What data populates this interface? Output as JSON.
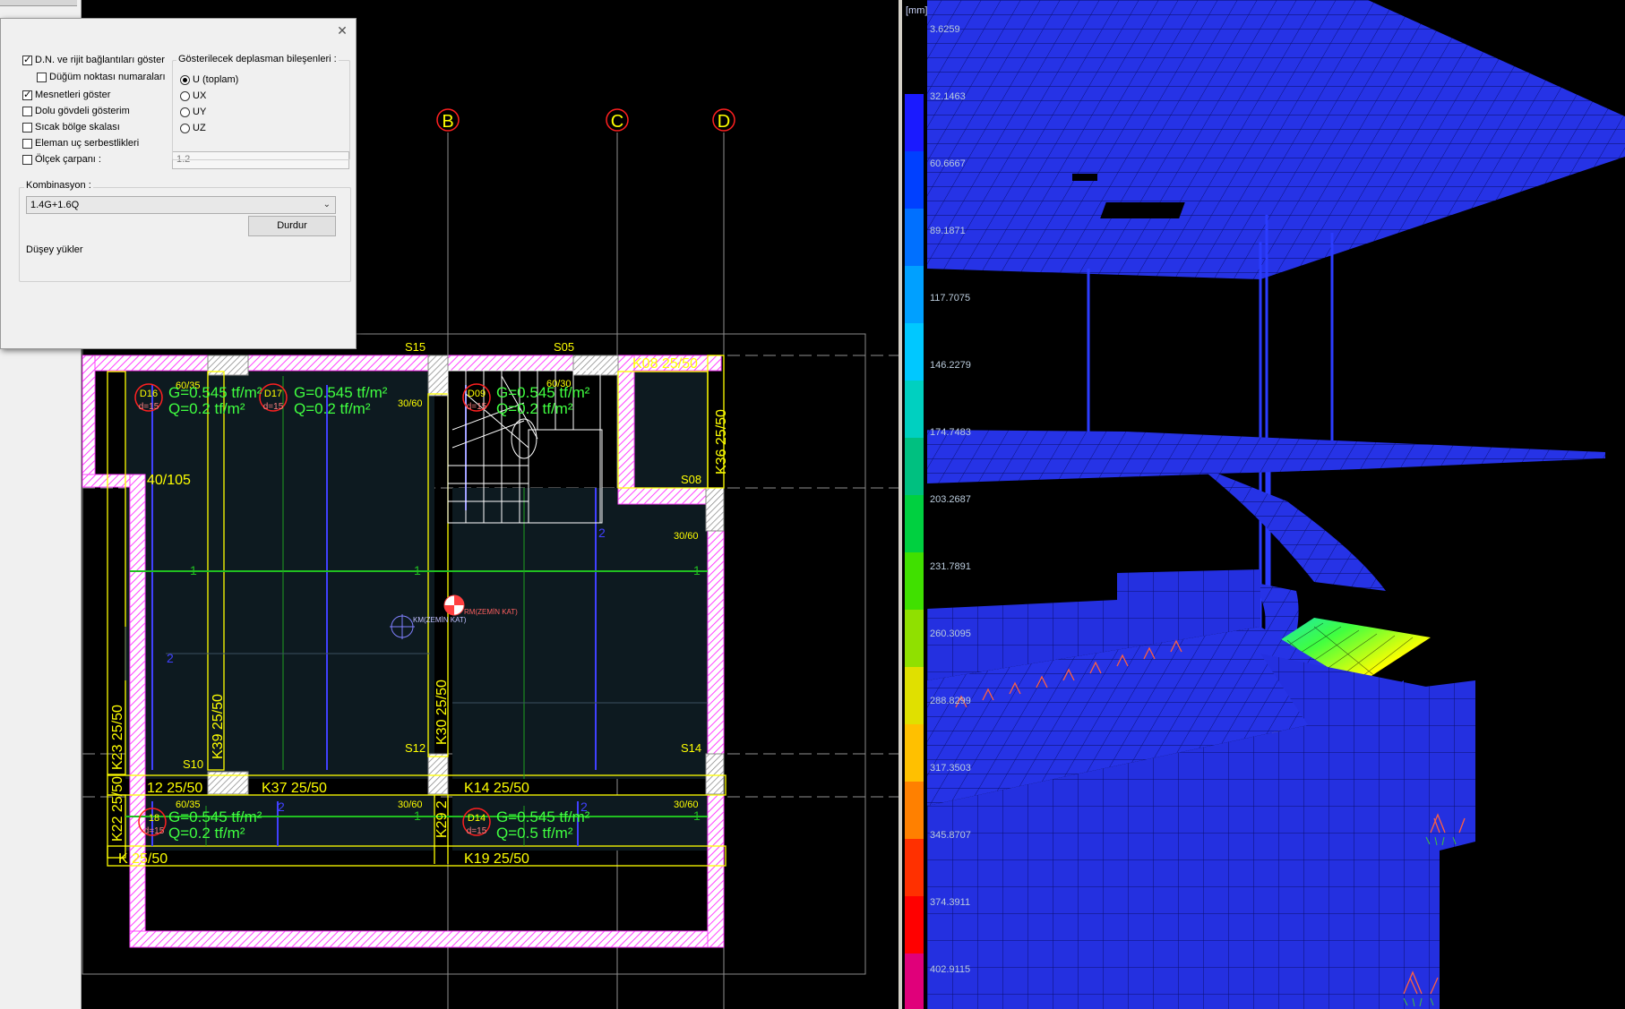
{
  "dialog": {
    "close_glyph": "✕",
    "checkboxes": [
      {
        "label": "D.N. ve rijit bağlantıları göster",
        "checked": true
      },
      {
        "label": "Düğüm noktası numaraları",
        "checked": false
      },
      {
        "label": "Mesnetleri göster",
        "checked": true
      },
      {
        "label": "Dolu gövdeli gösterim",
        "checked": false
      },
      {
        "label": "Sıcak bölge skalası",
        "checked": false
      },
      {
        "label": "Eleman uç serbestlikleri",
        "checked": false
      },
      {
        "label": "Ölçek çarpanı :",
        "checked": false
      }
    ],
    "scale_value": "1.2",
    "displacement_group_title": "Gösterilecek deplasman bileşenleri :",
    "radios": [
      {
        "label": "U (toplam)",
        "selected": true
      },
      {
        "label": "UX",
        "selected": false
      },
      {
        "label": "UY",
        "selected": false
      },
      {
        "label": "UZ",
        "selected": false
      }
    ],
    "combination_title": "Kombinasyon :",
    "combination_value": "1.4G+1.6Q",
    "stop_button": "Durdur",
    "load_label": "Düşey yükler"
  },
  "plan": {
    "axes": [
      {
        "label": "B"
      },
      {
        "label": "C"
      },
      {
        "label": "D"
      }
    ],
    "labels": {
      "s15": "S15",
      "s05": "S05",
      "s08": "S08",
      "s10": "S10",
      "s12": "S12",
      "s14": "S14",
      "k08": "K08 25/50",
      "k36": "K36 25/50",
      "k39": "K39 25/50",
      "k30": "K30 25/50",
      "k23": "K23 25/50",
      "k22": "K22 25/50",
      "k12": "12 25/50",
      "k37": "K37 25/50",
      "k14": "K14 25/50",
      "k29": "K29 2",
      "kbottom": "K   25/50",
      "k19": "K19 25/50",
      "k40": "40/105",
      "d16": "D16",
      "d17": "D17",
      "d09": "D09",
      "d18": "18",
      "d14": "D14",
      "d15": "d=15",
      "g1": "G=0.545 tf/m²",
      "q1": "Q=0.2 tf/m²",
      "g2": "G=0.545 tf/m²",
      "q2": "Q=0.2 tf/m²",
      "g3": "G=0.545 tf/m²",
      "q3": "Q=0.2 tf/m²",
      "g4": "G=0.545 tf/m²",
      "q4": "Q=0.2 tf/m²",
      "g5": "G=0.545 tf/m²",
      "q5": "Q=0.5 tf/m²",
      "c6035a": "60/35",
      "c3060a": "30/60",
      "c6030": "60/30",
      "c3060b": "30/60",
      "c6035b": "60/35",
      "c3060c": "30/60",
      "c3060d": "30/60",
      "km": "KM(ZEMİN KAT)",
      "rm": "RM(ZEMİN KAT)",
      "one": "1",
      "two": "2"
    }
  },
  "view3d": {
    "unit": "[mm]",
    "legend": [
      "3.6259",
      "32.1463",
      "60.6667",
      "89.1871",
      "117.7075",
      "146.2279",
      "174.7483",
      "203.2687",
      "231.7891",
      "260.3095",
      "288.8299",
      "317.3503",
      "345.8707",
      "374.3911",
      "402.9115"
    ],
    "legend_colors": [
      "#1a1aff",
      "#0040ff",
      "#0070ff",
      "#00a0ff",
      "#00c8ff",
      "#00d0c0",
      "#00c080",
      "#00d040",
      "#40e000",
      "#90e000",
      "#e0e000",
      "#ffc000",
      "#ff8000",
      "#ff3000",
      "#ff0000",
      "#e0007a"
    ]
  },
  "colors": {
    "grid": "#ffffff",
    "beam": "#ffff00",
    "wall": "#ff40ff",
    "slab_text": "#40ff40",
    "axis_circle": "#ff2020",
    "column_fill": "#ffffff"
  }
}
